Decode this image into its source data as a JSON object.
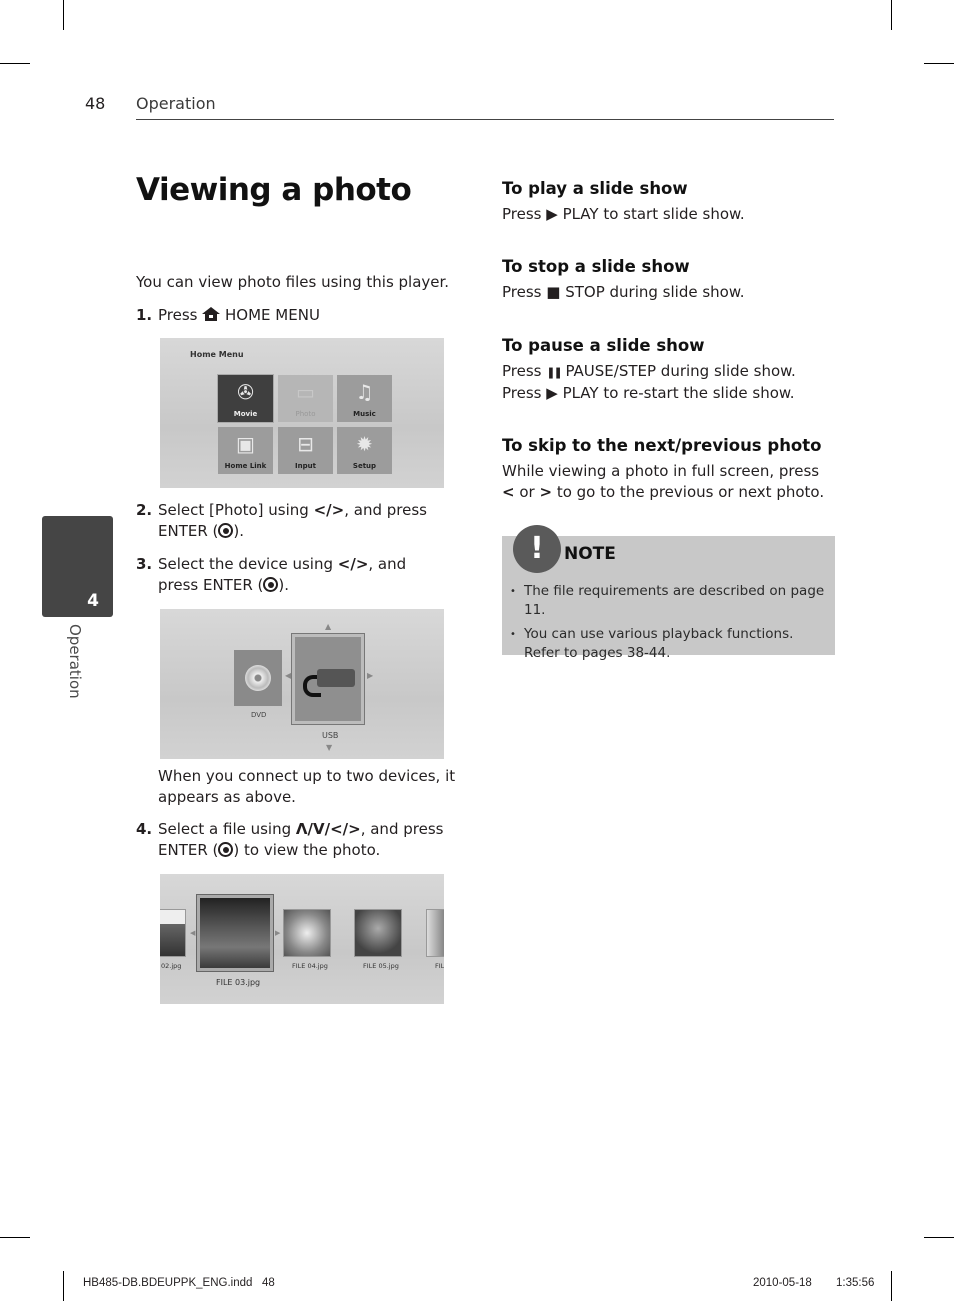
{
  "header": {
    "page_number": "48",
    "section": "Operation"
  },
  "side_tab": {
    "chapter_number": "4",
    "chapter_label": "Operation"
  },
  "title": "Viewing a photo",
  "intro": "You can view photo files using this player.",
  "steps": [
    {
      "num": "1.",
      "parts": [
        "Press ",
        "HOME MENU"
      ],
      "icon": "home-icon"
    },
    {
      "num": "2.",
      "text_a": "Select [Photo] using ",
      "keys": "</>",
      "text_b": ", and press ENTER (",
      "text_c": ")."
    },
    {
      "num": "3.",
      "text_a": "Select the device using ",
      "keys": "</>",
      "text_b": ", and press ENTER (",
      "text_c": ")."
    },
    {
      "num": "4.",
      "text_a": "Select a file using ",
      "keys": "Λ/V/</>",
      "text_b": ", and press ENTER (",
      "text_c": ") to view the photo."
    }
  ],
  "home_menu_screen": {
    "title": "Home Menu",
    "tiles": [
      {
        "label": "Movie",
        "icon": "film-reel-icon",
        "state": "selected"
      },
      {
        "label": "Photo",
        "icon": "photo-icon",
        "state": "disabled"
      },
      {
        "label": "Music",
        "icon": "music-note-icon",
        "state": "normal"
      },
      {
        "label": "Home Link",
        "icon": "monitor-icon",
        "state": "normal"
      },
      {
        "label": "Input",
        "icon": "radio-icon",
        "state": "normal"
      },
      {
        "label": "Setup",
        "icon": "gear-icon",
        "state": "normal"
      }
    ]
  },
  "device_screen": {
    "devices": [
      {
        "label": "DVD",
        "icon": "disc-icon",
        "selected": false
      },
      {
        "label": "USB",
        "icon": "usb-icon",
        "selected": true
      }
    ]
  },
  "device_caption": "When you connect up to two devices, it appears as above.",
  "file_screen": {
    "files": [
      {
        "label": "02.jpg",
        "selected": false
      },
      {
        "label": "FILE 03.jpg",
        "selected": true
      },
      {
        "label": "FILE 04.jpg",
        "selected": false
      },
      {
        "label": "FILE 05.jpg",
        "selected": false
      },
      {
        "label": "FIL",
        "selected": false
      }
    ]
  },
  "sections": [
    {
      "heading": "To play a slide show",
      "lines": [
        {
          "pre": "Press ",
          "icon": "▶",
          "icon_name": "play-icon",
          "post": " PLAY to start slide show."
        }
      ]
    },
    {
      "heading": "To stop a slide show",
      "lines": [
        {
          "pre": "Press ",
          "icon": "■",
          "icon_name": "stop-icon",
          "post": " STOP during slide show."
        }
      ]
    },
    {
      "heading": "To pause a slide show",
      "lines": [
        {
          "pre": "Press ",
          "icon": "❚❚",
          "icon_name": "pause-icon",
          "post": " PAUSE/STEP during slide show."
        },
        {
          "pre": "Press ",
          "icon": "▶",
          "icon_name": "play-icon",
          "post": " PLAY to re-start the slide show."
        }
      ]
    },
    {
      "heading": "To skip to the next/previous photo",
      "body_a": "While viewing a photo in full screen, press ",
      "key_a": "<",
      "body_b": " or ",
      "key_b": ">",
      "body_c": " to go to the previous or next photo."
    }
  ],
  "note": {
    "badge": "!",
    "title": "NOTE",
    "items": [
      "The file requirements are described on page 11.",
      "You can use various playback functions. Refer to pages 38-44."
    ]
  },
  "footer": {
    "file": "HB485-DB.BDEUPPK_ENG.indd   48",
    "date": "2010-05-18",
    "time": "1:35:56"
  }
}
